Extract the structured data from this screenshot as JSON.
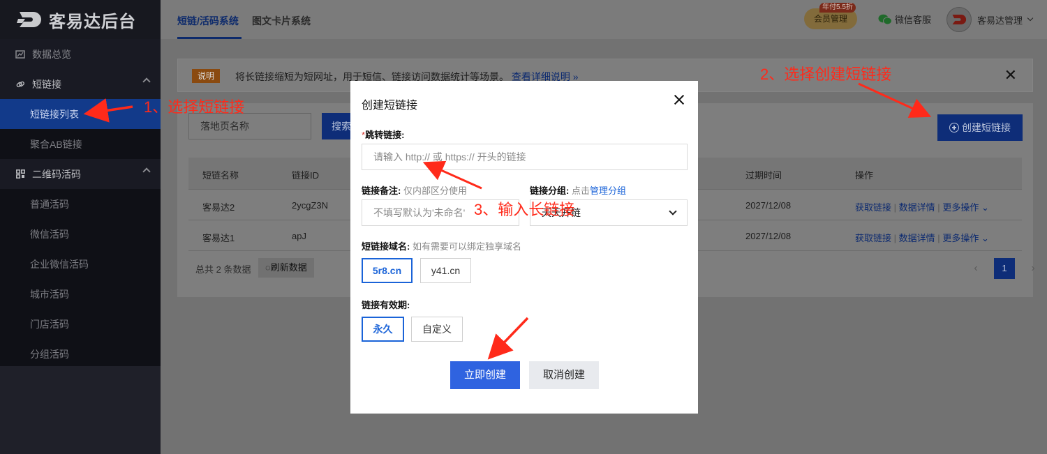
{
  "brand": {
    "logo_text": "客易达后台"
  },
  "sidebar": {
    "items": [
      {
        "label": "数据总览"
      },
      {
        "label": "短链接"
      },
      {
        "label": "短链接列表"
      },
      {
        "label": "聚合AB链接"
      },
      {
        "label": "二维码活码"
      },
      {
        "label": "普通活码"
      },
      {
        "label": "微信活码"
      },
      {
        "label": "企业微信活码"
      },
      {
        "label": "城市活码"
      },
      {
        "label": "门店活码"
      },
      {
        "label": "分组活码"
      }
    ]
  },
  "topbar": {
    "tabs": [
      {
        "label": "短链/活码系统"
      },
      {
        "label": "图文卡片系统"
      }
    ],
    "vip_label": "会员管理",
    "vip_badge": "年付5.5折",
    "wechat_service": "微信客服",
    "user_name": "客易达管理"
  },
  "notice": {
    "tag": "说明",
    "text": "将长链接缩短为短网址，用于短信、链接访问数据统计等场景。",
    "link": "查看详细说明 »"
  },
  "toolbar": {
    "search_placeholder": "落地页名称",
    "search_button": "搜索",
    "create_button": "创建短链接"
  },
  "table": {
    "headers": {
      "name": "短链名称",
      "id": "链接ID",
      "expire": "过期时间",
      "ops": "操作"
    },
    "rows": [
      {
        "name": "客易达2",
        "id": "2ycgZ3N",
        "expire": "2027/12/08"
      },
      {
        "name": "客易达1",
        "id": "apJ",
        "expire": "2027/12/08"
      }
    ],
    "ops": {
      "get_link": "获取链接",
      "sep": "|",
      "details": "数据详情",
      "more": "更多操作"
    },
    "total": "总共 2 条数据",
    "refresh": "刷新数据",
    "page": "1"
  },
  "modal": {
    "title": "创建短链接",
    "jump_label": "跳转链接:",
    "jump_placeholder": "请输入 http:// 或 https:// 开头的链接",
    "remark_label": "链接备注:",
    "remark_hint": "仅内部区分使用",
    "remark_placeholder": "不填写默认为'未命名'",
    "group_label": "链接分组:",
    "group_hint": "点击",
    "group_link": "管理分组",
    "group_value": "天天开链",
    "domain_label": "短链接域名:",
    "domain_hint": "如有需要可以绑定独享域名",
    "domains": [
      "5r8.cn",
      "y41.cn"
    ],
    "validity_label": "链接有效期:",
    "validity_options": [
      "永久",
      "自定义"
    ],
    "submit": "立即创建",
    "cancel": "取消创建"
  },
  "annotations": {
    "step1": "1、选择短链接",
    "step2": "2、选择创建短链接",
    "step3": "3、输入长链接"
  },
  "colors": {
    "primary": "#2f63e0",
    "annotation": "#ff2a1a",
    "sidebar_bg": "#191a23"
  }
}
